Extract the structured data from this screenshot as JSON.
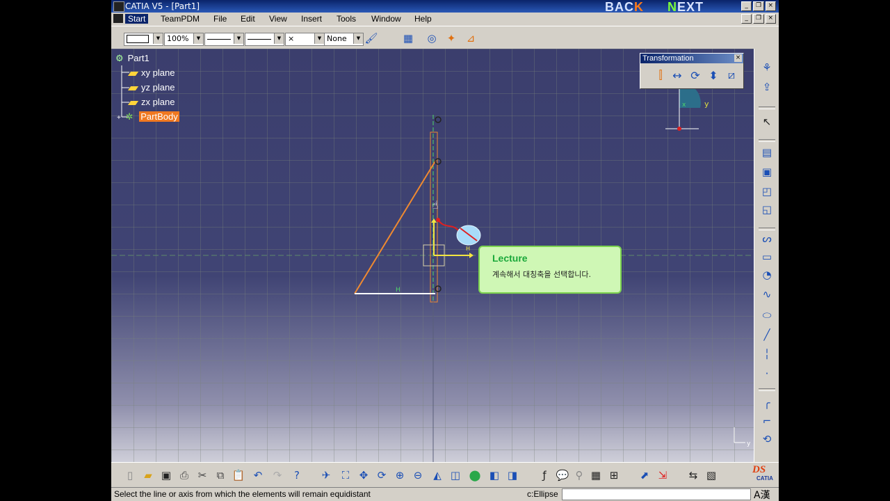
{
  "window": {
    "title": "CATIA V5 - [Part1]",
    "back_label": "BAC",
    "back_label_tail": "K",
    "next_label_head": "N",
    "next_label": "EXT",
    "min_glyph": "_",
    "max_glyph": "❐",
    "close_glyph": "×"
  },
  "menubar": {
    "items": [
      "Start",
      "TeamPDM",
      "File",
      "Edit",
      "View",
      "Insert",
      "Tools",
      "Window",
      "Help"
    ]
  },
  "toolbar": {
    "zoom_value": "100%",
    "none_value": "None",
    "x_value": "×"
  },
  "tree": {
    "root": "Part1",
    "items": [
      "xy plane",
      "yz plane",
      "zx plane"
    ],
    "partbody": "PartBody"
  },
  "transformation": {
    "title": "Transformation",
    "close": "×"
  },
  "compass": {
    "x_label": "x",
    "y_label": "y"
  },
  "corner_axis": {
    "y_label": "y"
  },
  "lecture": {
    "title": "Lecture",
    "body": "계속해서 대칭축을 선택합니다."
  },
  "status": {
    "message": "Select the line or axis from which the elements will remain equidistant",
    "command_label": "c:Ellipse",
    "ime_label": "A漢"
  },
  "logo": {
    "ds": "DS",
    "catia": "CATIA"
  },
  "colors": {
    "canvas": "#3a3d6c",
    "sketch_orange": "#f08a30",
    "sketch_white": "#ffffff",
    "axis_green": "#4fd86a",
    "highlight_yellow": "#f4e640",
    "lecture_bg": "#cff7b5",
    "lecture_title": "#1aa83a"
  }
}
